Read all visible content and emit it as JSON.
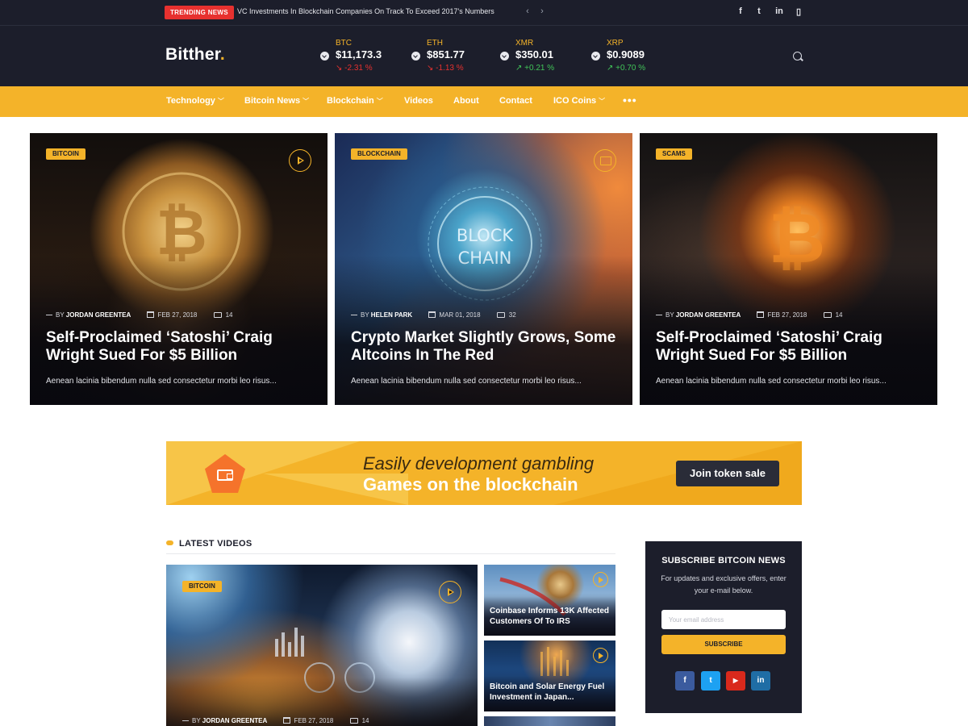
{
  "topbar": {
    "trending_label": "TRENDING NEWS",
    "trending_text": "VC Investments In Blockchain Companies On Track To Exceed 2017's Numbers",
    "prev_arrow": "‹",
    "next_arrow": "›",
    "social": [
      "f",
      "t",
      "in",
      "▯"
    ],
    "social_icons": [
      "facebook-icon",
      "twitter-icon",
      "linkedin-icon",
      "mobile-icon"
    ]
  },
  "header": {
    "logo": "Bitther",
    "logo_dot": ".",
    "tickers": [
      {
        "symbol": "BTC",
        "price": "$11,173.3",
        "change": "↘ -2.31 %",
        "trend": "down"
      },
      {
        "symbol": "ETH",
        "price": "$851.77",
        "change": "↘ -1.13 %",
        "trend": "down"
      },
      {
        "symbol": "XMR",
        "price": "$350.01",
        "change": "↗ +0.21 %",
        "trend": "up"
      },
      {
        "symbol": "XRP",
        "price": "$0.9089",
        "change": "↗ +0.70 %",
        "trend": "up"
      }
    ],
    "search_icon": "search-icon"
  },
  "nav": {
    "items": [
      {
        "label": "Technology",
        "has_dropdown": true
      },
      {
        "label": "Bitcoin News",
        "has_dropdown": true
      },
      {
        "label": "Blockchain",
        "has_dropdown": true
      },
      {
        "label": "Videos",
        "has_dropdown": false
      },
      {
        "label": "About",
        "has_dropdown": false
      },
      {
        "label": "Contact",
        "has_dropdown": false
      },
      {
        "label": "ICO Coins",
        "has_dropdown": true
      }
    ],
    "caret": "﹀",
    "more": "•••"
  },
  "featured": [
    {
      "category": "BITCOIN",
      "media": "play-icon",
      "by": "BY",
      "author": "JORDAN GREENTEA",
      "date": "FEB 27, 2018",
      "comments": "14",
      "title": "Self-Proclaimed ‘Satoshi’ Craig Wright Sued For $5 Billion",
      "excerpt": "Aenean lacinia bibendum nulla sed consectetur morbi leo risus..."
    },
    {
      "category": "BLOCKCHAIN",
      "media": "image-icon",
      "by": "BY",
      "author": "HELEN PARK",
      "date": "MAR 01, 2018",
      "comments": "32",
      "title": "Crypto Market Slightly Grows, Some Altcoins In The Red",
      "excerpt": "Aenean lacinia bibendum nulla sed consectetur morbi leo risus...",
      "image_text": "BLOCK CHAIN"
    },
    {
      "category": "SCAMS",
      "media": "none",
      "by": "BY",
      "author": "JORDAN GREENTEA",
      "date": "FEB 27, 2018",
      "comments": "14",
      "title": "Self-Proclaimed ‘Satoshi’ Craig Wright Sued For $5 Billion",
      "excerpt": "Aenean lacinia bibendum nulla sed consectetur morbi leo risus..."
    }
  ],
  "banner": {
    "line1": "Easily development gambling",
    "line2": "Games on the blockchain",
    "button": "Join token sale",
    "icon": "wallet-icon"
  },
  "latest_videos": {
    "section_title": "LATEST VIDEOS",
    "main": {
      "category": "BITCOIN",
      "by": "BY",
      "author": "JORDAN GREENTEA",
      "date": "FEB 27, 2018",
      "comments": "14"
    },
    "side": [
      {
        "title": "Coinbase Informs 13K Affected Customers Of To IRS"
      },
      {
        "title": "Bitcoin and Solar Energy Fuel Investment in Japan..."
      }
    ]
  },
  "subscribe": {
    "title": "SUBSCRIBE BITCOIN NEWS",
    "text": "For updates and exclusive offers, enter your e-mail below.",
    "placeholder": "Your email address",
    "button": "SUBSCRIBE",
    "social": [
      {
        "label": "f",
        "icon": "facebook-icon",
        "color": "#3b5b9e"
      },
      {
        "label": "t",
        "icon": "twitter-icon",
        "color": "#1da1f2"
      },
      {
        "label": "▶",
        "icon": "youtube-icon",
        "color": "#d9291c"
      },
      {
        "label": "in",
        "icon": "linkedin-icon",
        "color": "#1f6da5"
      }
    ]
  },
  "colors": {
    "accent": "#f4b329",
    "dark": "#1c1e2b",
    "down": "#e7312f",
    "up": "#41c458"
  }
}
